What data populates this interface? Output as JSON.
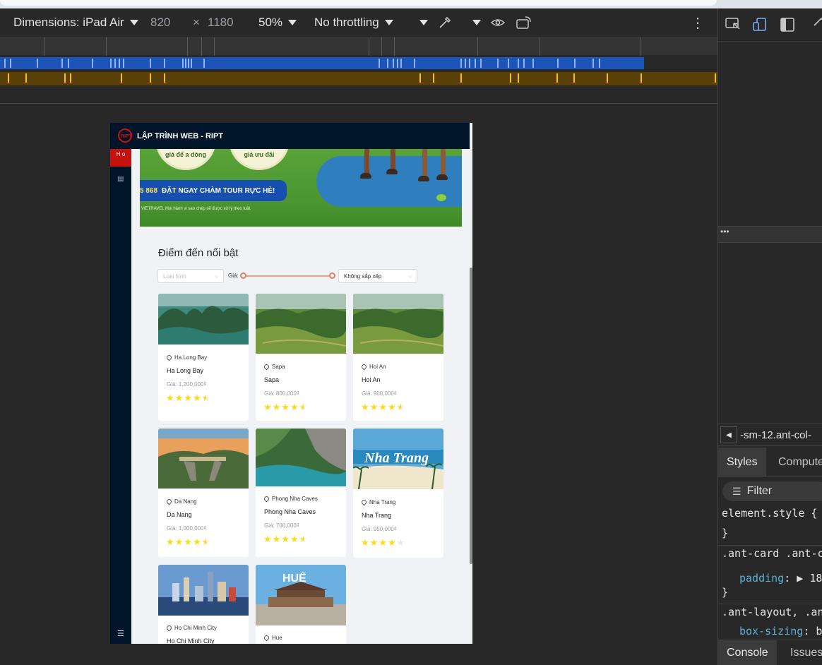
{
  "device_toolbar": {
    "dimensions_label": "Dimensions: iPad Air",
    "width": "820",
    "times": "×",
    "height": "1180",
    "zoom": "50%",
    "throttling": "No throttling",
    "more_icon": "more-vert-icon"
  },
  "app": {
    "header_title": "LẬP TRÌNH WEB - RIPT",
    "sider_selected_label": "H o",
    "banner": {
      "circle_left_text": "giá để a dòng",
      "circle_right_text": "giá ưu đãi",
      "cta_number": "5 868",
      "cta_text": "ĐẶT NGAY CHÀM TOUR RỰC HÈ!",
      "note": "VIETRAVEL Mọi hành vi sao chép sẽ được xử lý theo luật."
    },
    "section_title": "Điểm đến nổi bật",
    "filters": {
      "type_placeholder": "Loại hình",
      "price_label": "Giá:",
      "sort_value": "Không sắp xếp"
    },
    "cards": [
      {
        "location": "Ha Long Bay",
        "name": "Ha Long Bay",
        "price": "Giá: 1,200,000₫",
        "rating": 4.5
      },
      {
        "location": "Sapa",
        "name": "Sapa",
        "price": "Giá: 800,000₫",
        "rating": 4.5
      },
      {
        "location": "Hoi An",
        "name": "Hoi An",
        "price": "Giá: 900,000₫",
        "rating": 4.5
      },
      {
        "location": "Da Nang",
        "name": "Da Nang",
        "price": "Giá: 1,000,000₫",
        "rating": 4.5
      },
      {
        "location": "Phong Nha Caves",
        "name": "Phong Nha Caves",
        "price": "Giá: 700,000₫",
        "rating": 4.5
      },
      {
        "location": "Nha Trang",
        "name": "Nha Trang",
        "price": "Giá: 950,000₫",
        "rating": 4
      },
      {
        "location": "Ho Chi Minh City",
        "name": "Ho Chi Minh City",
        "price": "",
        "rating": null
      },
      {
        "location": "Hue",
        "name": "",
        "price": "",
        "rating": null
      }
    ],
    "nha_trang_overlay": "Nha Trang",
    "hue_overlay": "HUẾ"
  },
  "devtools": {
    "dots": "•••",
    "breadcrumb": "-sm-12.ant-col-",
    "tabs": [
      "Styles",
      "Compute"
    ],
    "filter_label": "Filter",
    "css_lines": [
      {
        "text": "element.style {"
      },
      {
        "text": "}"
      },
      {
        "text": ".ant-card .ant-c"
      },
      {
        "prop": "padding",
        "value": ": ▶ 18"
      },
      {
        "text": "}"
      },
      {
        "text": ".ant-layout, .an"
      },
      {
        "prop": "box-sizing",
        "value": ": b"
      }
    ],
    "bottom_tabs": [
      "Console",
      "Issues"
    ]
  }
}
